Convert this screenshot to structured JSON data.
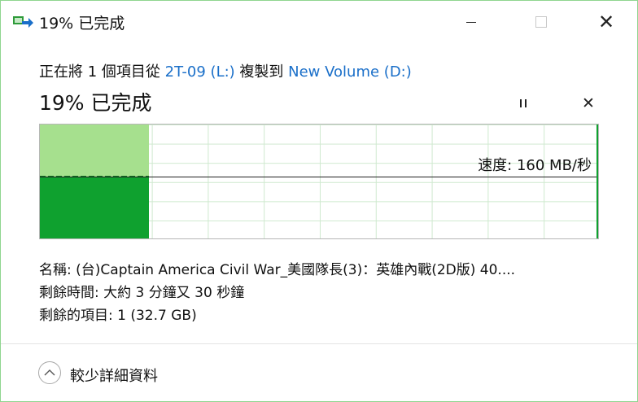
{
  "window": {
    "title": "19% 已完成"
  },
  "header": {
    "prefix": "正在將 1 個項目從 ",
    "source": "2T-09 (L:)",
    "middle": " 複製到 ",
    "destination": "New Volume (D:)",
    "status": "19% 已完成"
  },
  "progress": {
    "percent": 19,
    "speed_label": "速度: 160 MB/秒"
  },
  "details": {
    "name_label": "名稱: ",
    "name_value": "(台)Captain America Civil War_美國隊長(3)：英雄內戰(2D版) 40....",
    "time_label": "剩餘時間: ",
    "time_value": "大約 3 分鐘又 30 秒鐘",
    "items_label": "剩餘的項目: ",
    "items_value": "1 (32.7 GB)"
  },
  "footer": {
    "less_details": "較少詳細資料"
  },
  "icons": {
    "app": "copy-arrow-icon",
    "minimize": "minimize-icon",
    "maximize": "maximize-icon",
    "close": "close-icon",
    "pause": "pause-icon",
    "cancel": "cancel-icon",
    "chevron": "chevron-up-icon"
  },
  "colors": {
    "accent_link": "#1a6fc9",
    "graph_dark": "#0fa12f",
    "graph_light": "#a6e08e"
  }
}
